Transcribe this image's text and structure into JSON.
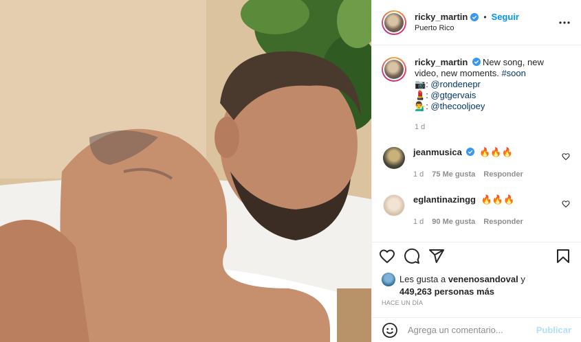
{
  "post": {
    "username": "ricky_martin",
    "follow_label": "Seguir",
    "separator": "•",
    "location": "Puerto Rico"
  },
  "caption": {
    "username": "ricky_martin",
    "line1": "New song, new video, new moments. ",
    "hashtag": "#soon",
    "credits": [
      {
        "emoji": "📷",
        "prefix": ": ",
        "handle": "@rondenepr"
      },
      {
        "emoji": "💄",
        "prefix": ": ",
        "handle": "@gtgervais"
      },
      {
        "emoji": "💁‍♂️",
        "prefix": ": ",
        "handle": "@thecooljoey"
      }
    ],
    "time": "1 d"
  },
  "comments": [
    {
      "username": "jeanmusica",
      "text": "🔥🔥🔥",
      "time": "1 d",
      "likes": "75 Me gusta",
      "reply_label": "Responder"
    },
    {
      "username": "eglantinazingg",
      "text": "🔥🔥🔥",
      "time": "1 d",
      "likes": "90 Me gusta",
      "reply_label": "Responder"
    }
  ],
  "likes": {
    "prefix": "Les gusta a ",
    "user": "venenosandoval",
    "middle": " y",
    "count": "449,263 personas más"
  },
  "time_ago": "HACE UN DÍA",
  "composer": {
    "placeholder": "Agrega un comentario...",
    "publish_label": "Publicar"
  },
  "colors": {
    "accent": "#0095f6",
    "verified": "#3897f0",
    "publish_disabled": "#b2dffc",
    "muted": "#8e8e8e"
  },
  "icons": [
    "verified-badge-icon",
    "more-options-icon",
    "heart-icon",
    "comment-icon",
    "share-icon",
    "bookmark-icon",
    "emoji-icon"
  ]
}
